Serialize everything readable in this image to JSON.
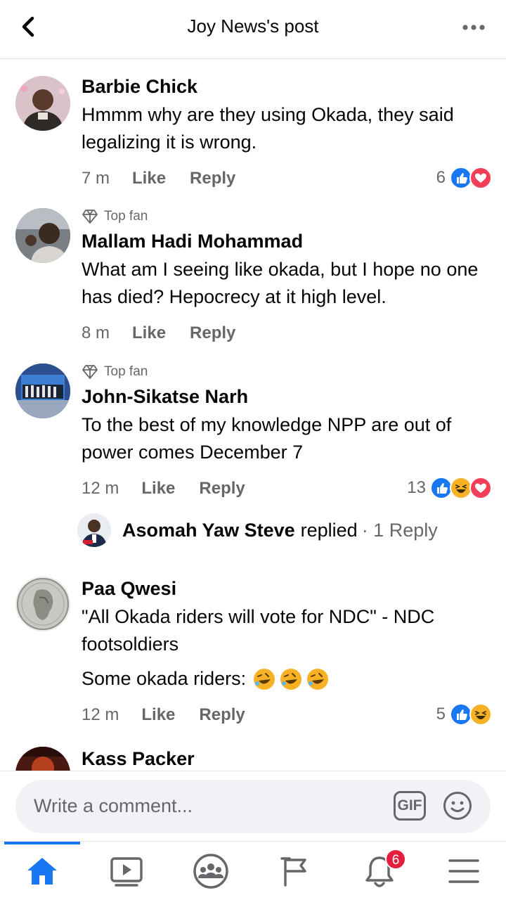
{
  "header": {
    "title": "Joy News's post",
    "back_icon": "chevron-left-icon",
    "more_icon": "ellipsis-icon"
  },
  "comments": [
    {
      "author": "Barbie Chick",
      "top_fan": "",
      "text": "Hmmm why are they using Okada, they said legalizing it is wrong.",
      "time": "7 m",
      "like": "Like",
      "reply": "Reply",
      "reaction_count": "6",
      "reactions": [
        "like",
        "love"
      ]
    },
    {
      "author": "Mallam Hadi Mohammad",
      "top_fan": "Top fan",
      "text": "What am I seeing like okada, but I hope no one has died? Hepocrecy at it high level.",
      "time": "8 m",
      "like": "Like",
      "reply": "Reply",
      "reaction_count": "",
      "reactions": []
    },
    {
      "author": "John-Sikatse Narh",
      "top_fan": "Top fan",
      "text": "To the best of my knowledge NPP are out of power comes December 7",
      "time": "12 m",
      "like": "Like",
      "reply": "Reply",
      "reaction_count": "13",
      "reactions": [
        "like",
        "haha",
        "love"
      ],
      "replies": {
        "name": "Asomah Yaw Steve",
        "verb": "replied",
        "count": "· 1 Reply"
      }
    },
    {
      "author": "Paa Qwesi",
      "top_fan": "",
      "text": "\"All Okada riders will vote for NDC\" - NDC footsoldiers",
      "text2": "Some okada riders:",
      "time": "12 m",
      "like": "Like",
      "reply": "Reply",
      "reaction_count": "5",
      "reactions": [
        "like",
        "haha"
      ]
    },
    {
      "author": "Kass Packer"
    }
  ],
  "composer": {
    "placeholder": "Write a comment...",
    "gif_label": "GIF"
  },
  "nav": {
    "notifications_badge": "6"
  },
  "colors": {
    "accent": "#1877f2",
    "love": "#f33e58",
    "haha": "#f7b125",
    "badge": "#e41e3f",
    "secondary_text": "#65676b"
  }
}
